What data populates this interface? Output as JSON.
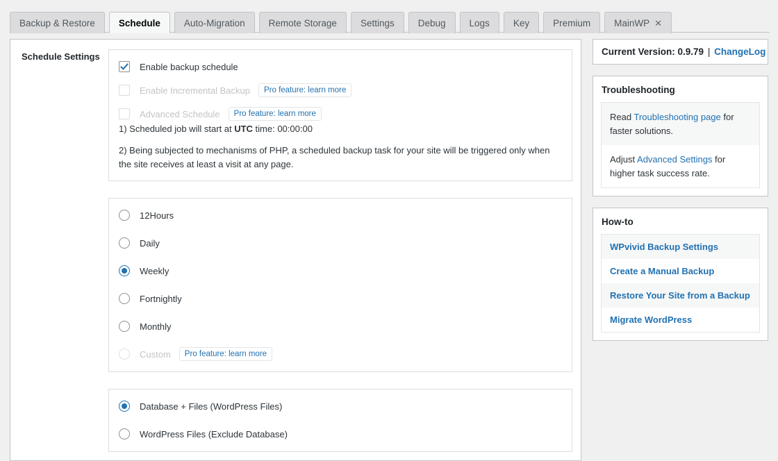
{
  "tabs": [
    {
      "label": "Backup & Restore",
      "active": false,
      "closable": false
    },
    {
      "label": "Schedule",
      "active": true,
      "closable": false
    },
    {
      "label": "Auto-Migration",
      "active": false,
      "closable": false
    },
    {
      "label": "Remote Storage",
      "active": false,
      "closable": false
    },
    {
      "label": "Settings",
      "active": false,
      "closable": false
    },
    {
      "label": "Debug",
      "active": false,
      "closable": false
    },
    {
      "label": "Logs",
      "active": false,
      "closable": false
    },
    {
      "label": "Key",
      "active": false,
      "closable": false
    },
    {
      "label": "Premium",
      "active": false,
      "closable": false
    },
    {
      "label": "MainWP",
      "active": false,
      "closable": true,
      "close_icon": "close-icon"
    }
  ],
  "main": {
    "section_label": "Schedule Settings",
    "enable_panel": {
      "checkboxes": [
        {
          "label": "Enable backup schedule",
          "checked": true,
          "disabled": false,
          "pro": null
        },
        {
          "label": "Enable Incremental Backup",
          "checked": false,
          "disabled": true,
          "pro": "Pro feature: learn more"
        },
        {
          "label": "Advanced Schedule",
          "checked": false,
          "disabled": true,
          "pro": "Pro feature: learn more"
        }
      ],
      "note1_pre": "1) Scheduled job will start at ",
      "note1_bold": "UTC",
      "note1_post": " time: 00:00:00",
      "note2": "2) Being subjected to mechanisms of PHP, a scheduled backup task for your site will be triggered only when the site receives at least a visit at any page."
    },
    "frequency_panel": {
      "options": [
        {
          "label": "12Hours",
          "selected": false,
          "disabled": false,
          "pro": null
        },
        {
          "label": "Daily",
          "selected": false,
          "disabled": false,
          "pro": null
        },
        {
          "label": "Weekly",
          "selected": true,
          "disabled": false,
          "pro": null
        },
        {
          "label": "Fortnightly",
          "selected": false,
          "disabled": false,
          "pro": null
        },
        {
          "label": "Monthly",
          "selected": false,
          "disabled": false,
          "pro": null
        },
        {
          "label": "Custom",
          "selected": false,
          "disabled": true,
          "pro": "Pro feature: learn more"
        }
      ]
    },
    "scope_panel": {
      "options": [
        {
          "label": "Database + Files (WordPress Files)",
          "selected": true
        },
        {
          "label": "WordPress Files (Exclude Database)",
          "selected": false
        }
      ]
    }
  },
  "sidebar": {
    "version": {
      "text": "Current Version: 0.9.79",
      "separator": "|",
      "changelog_link": "ChangeLog"
    },
    "troubleshooting": {
      "title": "Troubleshooting",
      "items": [
        {
          "pre": "Read ",
          "link": "Troubleshooting page",
          "post": " for faster solutions."
        },
        {
          "pre": "Adjust ",
          "link": "Advanced Settings",
          "post": " for higher task success rate."
        }
      ]
    },
    "howto": {
      "title": "How-to",
      "items": [
        "WPvivid Backup Settings",
        "Create a Manual Backup",
        "Restore Your Site from a Backup",
        "Migrate WordPress"
      ]
    }
  },
  "colors": {
    "link": "#2271b1",
    "page_bg": "#f0f0f1",
    "border": "#c3c4c7"
  }
}
